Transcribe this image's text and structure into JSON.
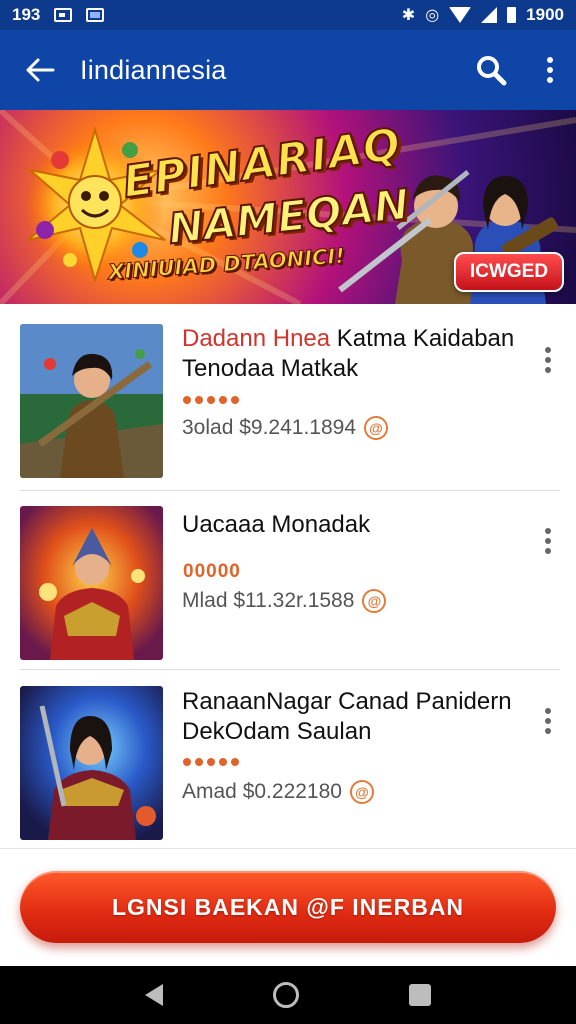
{
  "status_bar": {
    "time": "193",
    "clock": "1900",
    "icons": [
      "image-icon",
      "mail-icon",
      "bluetooth-icon",
      "alarm-icon",
      "wifi-icon",
      "signal-icon",
      "battery-icon"
    ]
  },
  "app_bar": {
    "title": "Iindiannesia",
    "icons": [
      "back-arrow-icon",
      "search-icon",
      "more-vert-icon"
    ]
  },
  "banner": {
    "title_line1": "EPINARIAQ",
    "title_line2": "NAMEQAN",
    "subtitle": "XINIUIAD DTAONICI!",
    "badge": "ICWGED"
  },
  "games": [
    {
      "title_highlight": "Dadann Hnea",
      "title_rest": " Katma Kaidaban Tenodaa Matkak",
      "rating_display": "stars",
      "rating_value": 5,
      "price": "3olad $9.241.1894",
      "coin_symbol": "@"
    },
    {
      "title_highlight": "",
      "title_rest": "Uacaaa Monadak",
      "rating_display": "text",
      "rating_text": "00000",
      "price": "Mlad $11.32r.1588",
      "coin_symbol": "@"
    },
    {
      "title_highlight": "",
      "title_rest": "RanaanNagar Canad Panidern DekOdam Saulan",
      "rating_display": "stars",
      "rating_value": 5,
      "price": "Amad $0.222180",
      "coin_symbol": "@"
    }
  ],
  "cta": {
    "label": "LGNSI BAEKAN @F INERBAN"
  },
  "nav_bar": {
    "icons": [
      "nav-back-icon",
      "nav-home-icon",
      "nav-recents-icon"
    ]
  },
  "colors": {
    "status_bar": "#0d3a8c",
    "app_bar": "#0e45a6",
    "accent_red": "#d0342c",
    "rating_orange": "#e0632a",
    "cta_red": "#e02a12"
  }
}
